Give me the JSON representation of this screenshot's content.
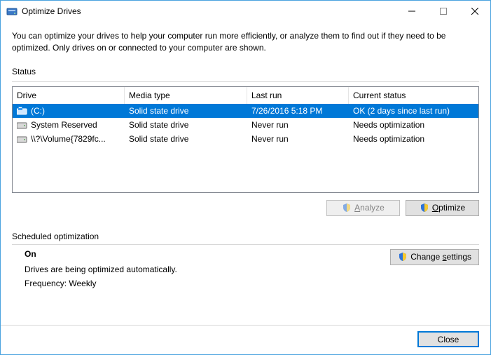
{
  "window": {
    "title": "Optimize Drives"
  },
  "intro": "You can optimize your drives to help your computer run more efficiently, or analyze them to find out if they need to be optimized. Only drives on or connected to your computer are shown.",
  "status_label": "Status",
  "columns": {
    "drive": "Drive",
    "media": "Media type",
    "lastrun": "Last run",
    "status": "Current status"
  },
  "rows": [
    {
      "drive": "(C:)",
      "media": "Solid state drive",
      "lastrun": "7/26/2016 5:18 PM",
      "status": "OK (2 days since last run)",
      "selected": true,
      "iconType": "os"
    },
    {
      "drive": "System Reserved",
      "media": "Solid state drive",
      "lastrun": "Never run",
      "status": "Needs optimization",
      "selected": false,
      "iconType": "hdd"
    },
    {
      "drive": "\\\\?\\Volume{7829fc...",
      "media": "Solid state drive",
      "lastrun": "Never run",
      "status": "Needs optimization",
      "selected": false,
      "iconType": "hdd"
    }
  ],
  "buttons": {
    "analyze_prefix": "",
    "analyze_u": "A",
    "analyze_suffix": "nalyze",
    "optimize_prefix": "",
    "optimize_u": "O",
    "optimize_suffix": "ptimize",
    "change_prefix": "Change ",
    "change_u": "s",
    "change_suffix": "ettings",
    "close": "Close"
  },
  "scheduled": {
    "label": "Scheduled optimization",
    "on": "On",
    "desc": "Drives are being optimized automatically.",
    "freq": "Frequency: Weekly"
  }
}
